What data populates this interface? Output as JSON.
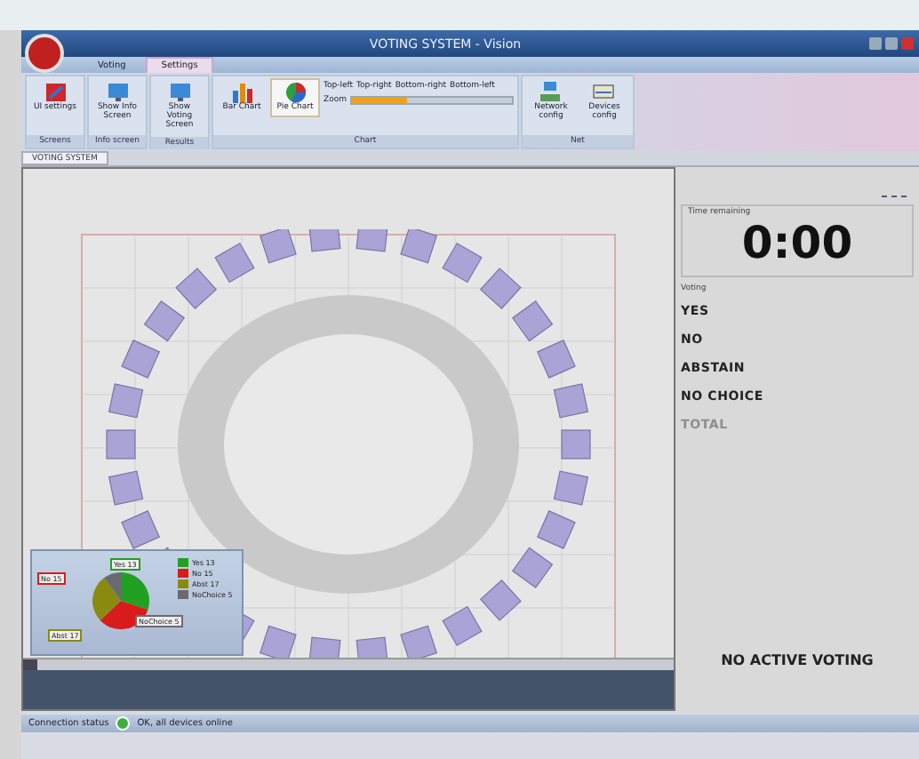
{
  "window": {
    "title": "VOTING SYSTEM - Vision"
  },
  "ribbon_tabs": [
    {
      "label": "Voting",
      "selected": false
    },
    {
      "label": "Settings",
      "selected": true
    }
  ],
  "ribbon_groups": [
    {
      "label": "Screens",
      "buttons": [
        {
          "label": "UI settings",
          "kind": "settings",
          "selected": false
        }
      ]
    },
    {
      "label": "Info screen",
      "buttons": [
        {
          "label": "Show Info Screen",
          "kind": "monitor",
          "selected": false
        }
      ]
    },
    {
      "label": "Results",
      "buttons": [
        {
          "label": "Show Voting Screen",
          "kind": "monitor",
          "selected": false
        }
      ]
    },
    {
      "label": "Chart",
      "buttons": [
        {
          "label": "Bar Chart",
          "kind": "bar",
          "selected": false
        },
        {
          "label": "Pie Chart",
          "kind": "pie",
          "selected": true
        }
      ],
      "positions": [
        "Top-left",
        "Top-right",
        "Bottom-right",
        "Bottom-left"
      ],
      "zoom_label": "Zoom",
      "zoom": {
        "level": 0.35
      }
    },
    {
      "label": "Net",
      "buttons": [
        {
          "label": "Network config",
          "kind": "network",
          "selected": false
        },
        {
          "label": "Devices config",
          "kind": "devices",
          "selected": false
        }
      ]
    }
  ],
  "document_tab": "VOTING SYSTEM",
  "chart_inset": {
    "callouts": [
      {
        "label": "Yes 13",
        "color": "#22a022"
      },
      {
        "label": "No 15",
        "color": "#d81c1c"
      },
      {
        "label": "Abst 17",
        "color": "#8a8a10"
      },
      {
        "label": "NoChoice 5",
        "color": "#6a6a70"
      }
    ],
    "legend": [
      {
        "label": "Yes 13",
        "color": "#22a022"
      },
      {
        "label": "No 15",
        "color": "#d81c1c"
      },
      {
        "label": "Abst 17",
        "color": "#8a8a10"
      },
      {
        "label": "NoChoice 5",
        "color": "#6a6a70"
      }
    ]
  },
  "side_panel": {
    "time_label": "Time remaining",
    "time": "0:00",
    "voting_label": "Voting",
    "results": [
      {
        "label": "YES",
        "disabled": false
      },
      {
        "label": "NO",
        "disabled": false
      },
      {
        "label": "ABSTAIN",
        "disabled": false
      },
      {
        "label": "NO CHOICE",
        "disabled": false
      },
      {
        "label": "TOTAL",
        "disabled": true
      }
    ],
    "status": "NO ACTIVE VOTING"
  },
  "status_bar": {
    "label": "Connection status",
    "online": true,
    "message": "OK, all devices online"
  }
}
